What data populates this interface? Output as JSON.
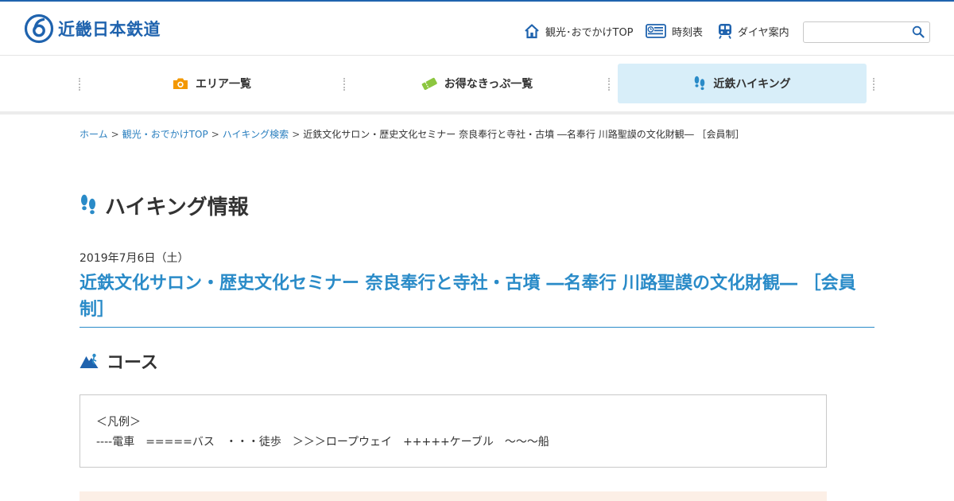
{
  "header": {
    "logo_text": "近畿日本鉄道",
    "nav": [
      {
        "label": "観光･おでかけTOP",
        "icon": "house-icon"
      },
      {
        "label": "時刻表",
        "icon": "timetable-icon"
      },
      {
        "label": "ダイヤ案内",
        "icon": "train-icon"
      }
    ],
    "search": {
      "placeholder": "",
      "value": ""
    }
  },
  "gnav": [
    {
      "label": "エリア一覧",
      "icon": "camera-icon",
      "color": "#f39800"
    },
    {
      "label": "お得なきっぷ一覧",
      "icon": "ticket-icon",
      "color": "#8cc63f"
    },
    {
      "label": "近鉄ハイキング",
      "icon": "footprints-icon",
      "color": "#2a8bc8",
      "active": true
    }
  ],
  "breadcrumb": {
    "items": [
      {
        "label": "ホーム",
        "link": true
      },
      {
        "label": "観光・おでかけTOP",
        "link": true
      },
      {
        "label": "ハイキング検索",
        "link": true
      },
      {
        "label": "近鉄文化サロン・歴史文化セミナー 奈良奉行と寺社・古墳 ―名奉行 川路聖謨の文化財観― ［会員制］",
        "link": false
      }
    ],
    "separator": ">"
  },
  "page": {
    "heading": "ハイキング情報",
    "date": "2019年7月6日（土）",
    "title": "近鉄文化サロン・歴史文化セミナー 奈良奉行と寺社・古墳 ―名奉行 川路聖謨の文化財観― ［会員制］",
    "course_heading": "コース",
    "legend_title": "＜凡例＞",
    "legend_text": "----電車　=====バス　・・・徒歩　＞＞＞ロープウェイ　+++++ケーブル　〜〜〜船"
  },
  "colors": {
    "brand": "#1f63ae",
    "accent": "#2a8bc8",
    "area": "#f39800",
    "ticket": "#8cc63f"
  }
}
